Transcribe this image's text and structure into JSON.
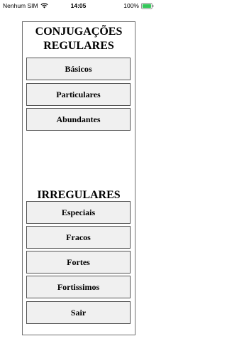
{
  "status_bar": {
    "carrier": "Nenhum SIM",
    "time": "14:05",
    "battery": "100%",
    "icons": [
      "wifi-icon",
      "battery-icon"
    ]
  },
  "regulares": {
    "heading_line1": "CONJUGAÇÕES",
    "heading_line2": "REGULARES",
    "buttons": [
      "Básicos",
      "Particulares",
      "Abundantes"
    ]
  },
  "irregulares": {
    "heading": "IRREGULARES",
    "buttons": [
      "Especiais",
      "Fracos",
      "Fortes",
      "Fortissimos",
      "Sair"
    ]
  },
  "colors": {
    "button_bg": "#f0f0f0",
    "button_border": "#555555",
    "panel_border": "#6f6f6f",
    "battery_green": "#34c759"
  }
}
